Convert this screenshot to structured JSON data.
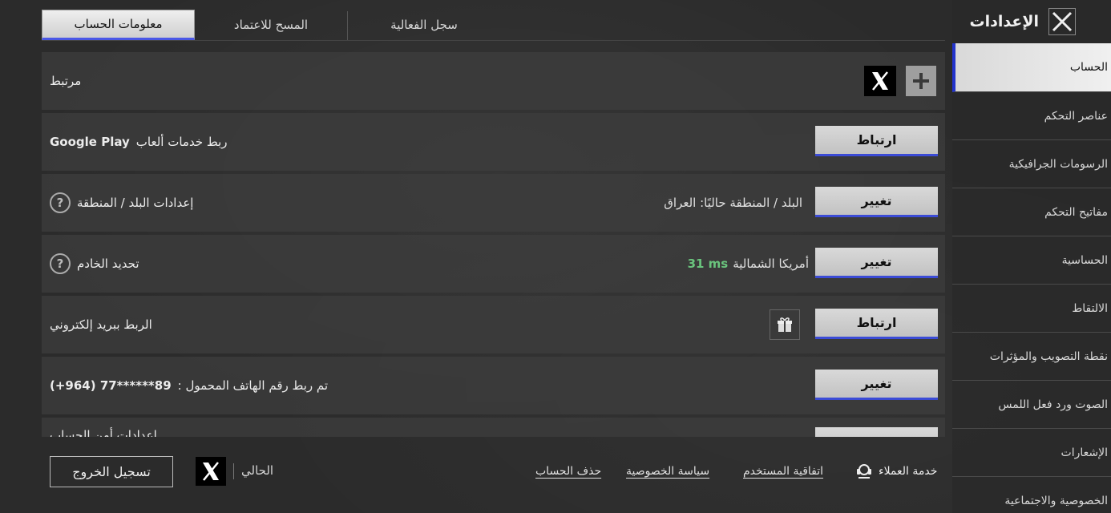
{
  "sidebar": {
    "title": "الإعدادات",
    "items": [
      {
        "label": "الحساب",
        "active": true
      },
      {
        "label": "عناصر التحكم"
      },
      {
        "label": "الرسومات الجرافيكية"
      },
      {
        "label": "مفاتيح التحكم"
      },
      {
        "label": "الحساسية"
      },
      {
        "label": "الالتقاط"
      },
      {
        "label": "نقطة التصويب والمؤثرات"
      },
      {
        "label": "الصوت ورد فعل اللمس"
      },
      {
        "label": "الإشعارات"
      },
      {
        "label": "الخصوصية والاجتماعية"
      }
    ]
  },
  "tabs": [
    {
      "label": "معلومات الحساب",
      "active": true
    },
    {
      "label": "المسح للاعتماد"
    },
    {
      "label": "سجل الفعالية"
    }
  ],
  "rows": {
    "linked": {
      "label": "مرتبط"
    },
    "google_play": {
      "label": "ربط خدمات ألعاب",
      "brand": "Google Play",
      "button": "ارتباط"
    },
    "region": {
      "label": "إعدادات البلد / المنطقة",
      "info": "البلد / المنطقة حاليًا: العراق",
      "button": "تغيير"
    },
    "server": {
      "label": "تحديد الخادم",
      "info": "أمريكا الشمالية",
      "ping": "31 ms",
      "button": "تغيير"
    },
    "email": {
      "label": "الربط ببريد إلكتروني",
      "button": "ارتباط"
    },
    "phone": {
      "label": "تم ربط رقم الهاتف المحمول :",
      "number": "(+964) 77******89",
      "button": "تغيير"
    },
    "security": {
      "label": "إعدادات أمن الحساب"
    }
  },
  "footer": {
    "logout": "تسجيل الخروج",
    "current": "الحالي",
    "delete_account": "حذف الحساب",
    "privacy_policy": "سياسة الخصوصية",
    "user_agreement": "اتفاقية المستخدم",
    "customer_service": "خدمة العملاء"
  },
  "colors": {
    "accent": "#3b4bd6",
    "ping": "#6ac47d"
  }
}
